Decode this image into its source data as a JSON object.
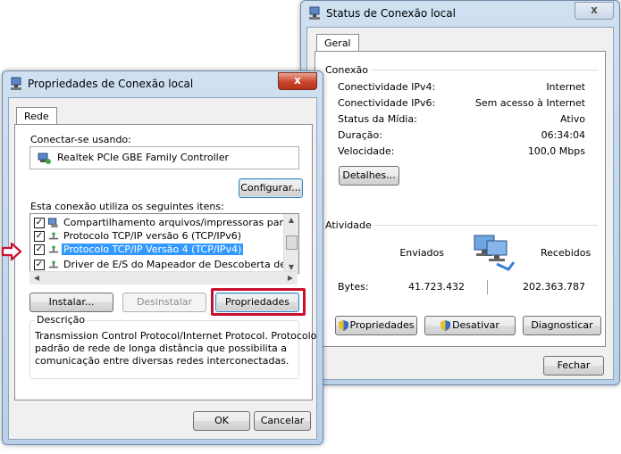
{
  "props_window": {
    "title": "Propriedades de Conexão local",
    "close": "x",
    "tab": "Rede",
    "connect_using_label": "Conectar-se usando:",
    "adapter_name": "Realtek PCIe GBE Family Controller",
    "configure_button": "Configurar...",
    "items_label": "Esta conexão utiliza os seguintes itens:",
    "items": [
      {
        "label": "Compartilhamento arquivos/impressoras para redes Mic",
        "checked": true
      },
      {
        "label": "Protocolo TCP/IP versão 6 (TCP/IPv6)",
        "checked": true
      },
      {
        "label": "Protocolo TCP/IP Versão 4 (TCP/IPv4)",
        "checked": true,
        "selected": true
      },
      {
        "label": "Driver de E/S do Mapeador de Descoberta de Topoloc",
        "checked": true
      }
    ],
    "install_button": "Instalar...",
    "uninstall_button": "Desinstalar",
    "properties_button": "Propriedades",
    "description_title": "Descrição",
    "description_text_1": "Transmission Control Protocol/Internet Protocol. Protocolo",
    "description_text_2": "padrão de rede de longa distância que possibilita a",
    "description_text_3": "comunicação entre diversas redes interconectadas.",
    "ok_button": "OK",
    "cancel_button": "Cancelar"
  },
  "status_window": {
    "title": "Status de Conexão local",
    "close": "x",
    "tab": "Geral",
    "connection_section": "Conexão",
    "rows": [
      {
        "label": "Conectividade IPv4:",
        "value": "Internet"
      },
      {
        "label": "Conectividade IPv6:",
        "value": "Sem acesso à Internet"
      },
      {
        "label": "Status da Mídia:",
        "value": "Ativo"
      },
      {
        "label": "Duração:",
        "value": "06:34:04"
      },
      {
        "label": "Velocidade:",
        "value": "100,0 Mbps"
      }
    ],
    "details_button": "Detalhes...",
    "activity_section": "Atividade",
    "sent_label": "Enviados",
    "received_label": "Recebidos",
    "bytes_label": "Bytes:",
    "bytes_sent": "41.723.432",
    "bytes_received": "202.363.787",
    "properties_button": "Propriedades",
    "disable_button": "Desativar",
    "diagnose_button": "Diagnosticar",
    "close_button": "Fechar"
  },
  "colors": {
    "highlight": "#c8102e",
    "selection": "#3399ff"
  }
}
